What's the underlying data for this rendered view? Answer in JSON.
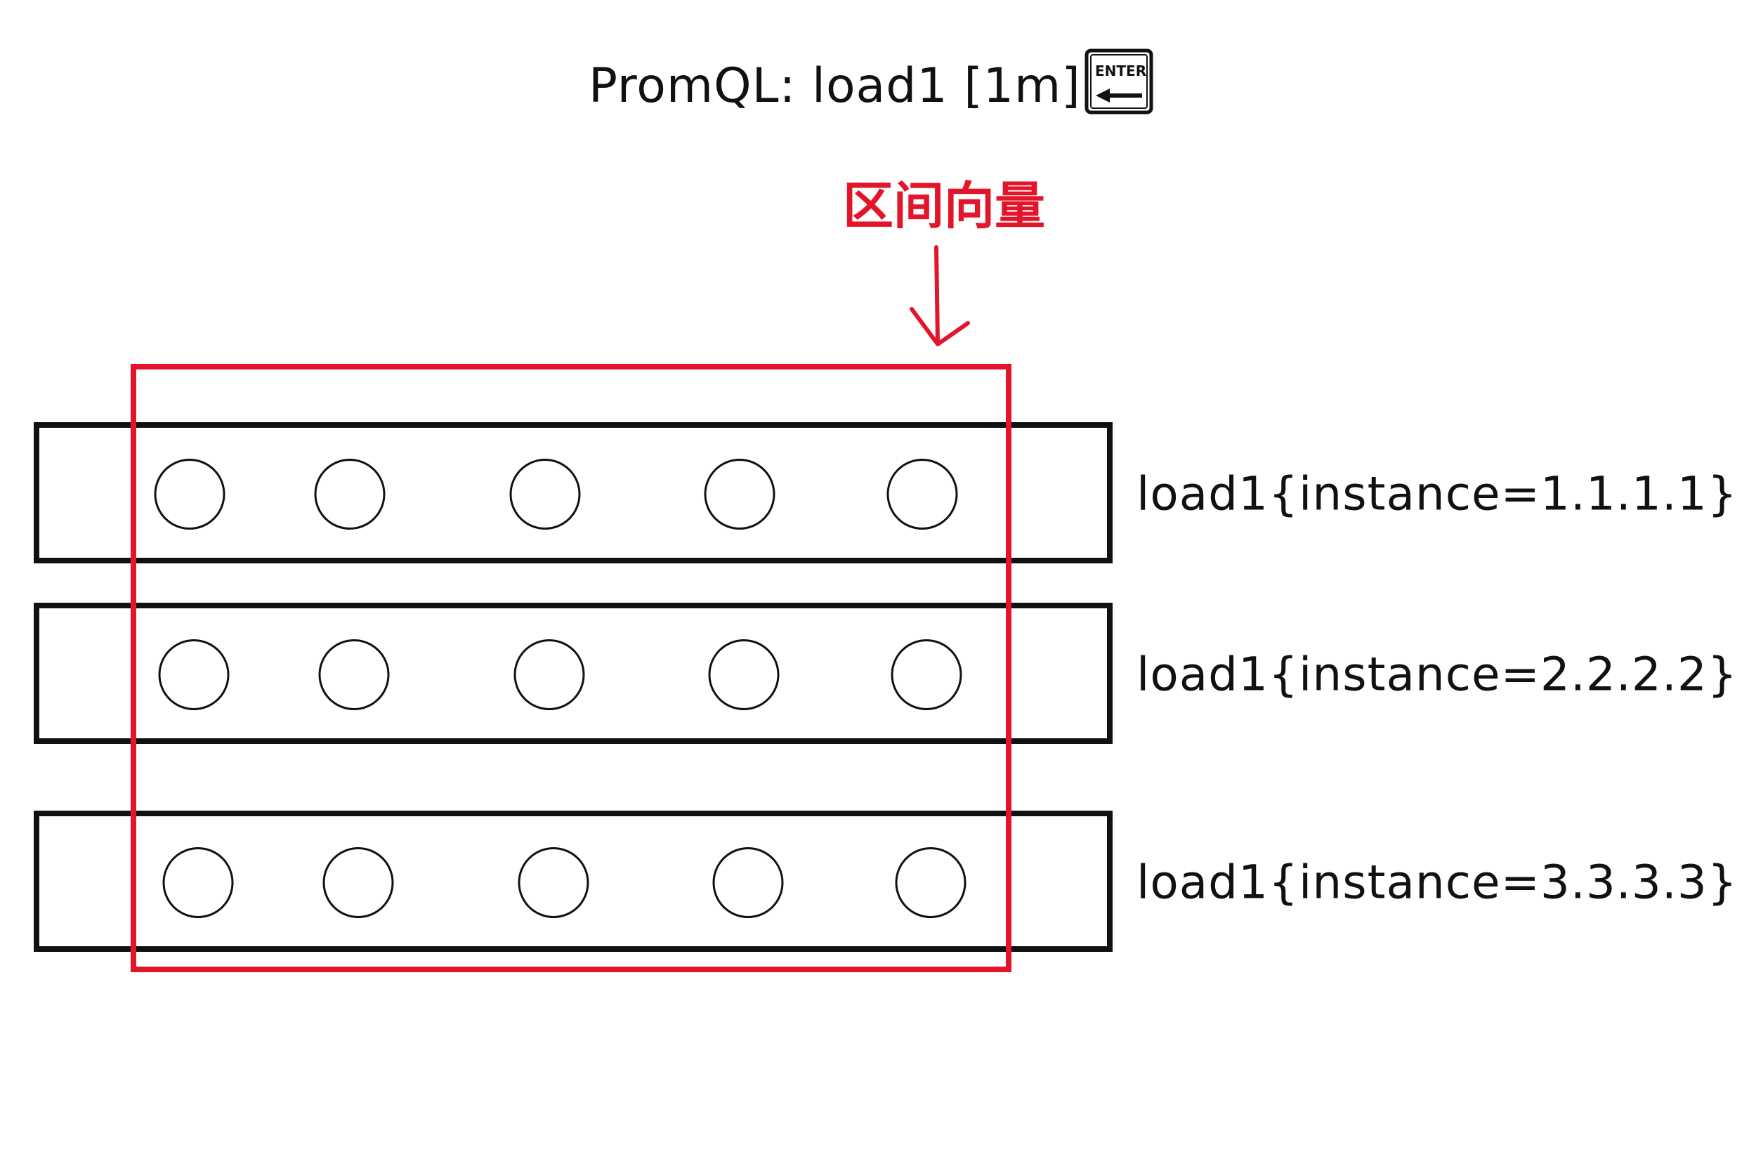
{
  "query": {
    "text": "PromQL: load1 [1m]",
    "enter_key_label": "ENTER",
    "enter_key_icon": "enter-key-icon"
  },
  "annotation": {
    "label": "区间向量",
    "color": "#e3152a",
    "arrow_icon": "arrow-down-icon"
  },
  "series": [
    {
      "label": "load1{instance=1.1.1.1}",
      "samples": 5
    },
    {
      "label": "load1{instance=2.2.2.2}",
      "samples": 5
    },
    {
      "label": "load1{instance=3.3.3.3}",
      "samples": 5
    }
  ],
  "colors": {
    "stroke": "#111111",
    "highlight": "#e3152a",
    "background": "#ffffff"
  }
}
